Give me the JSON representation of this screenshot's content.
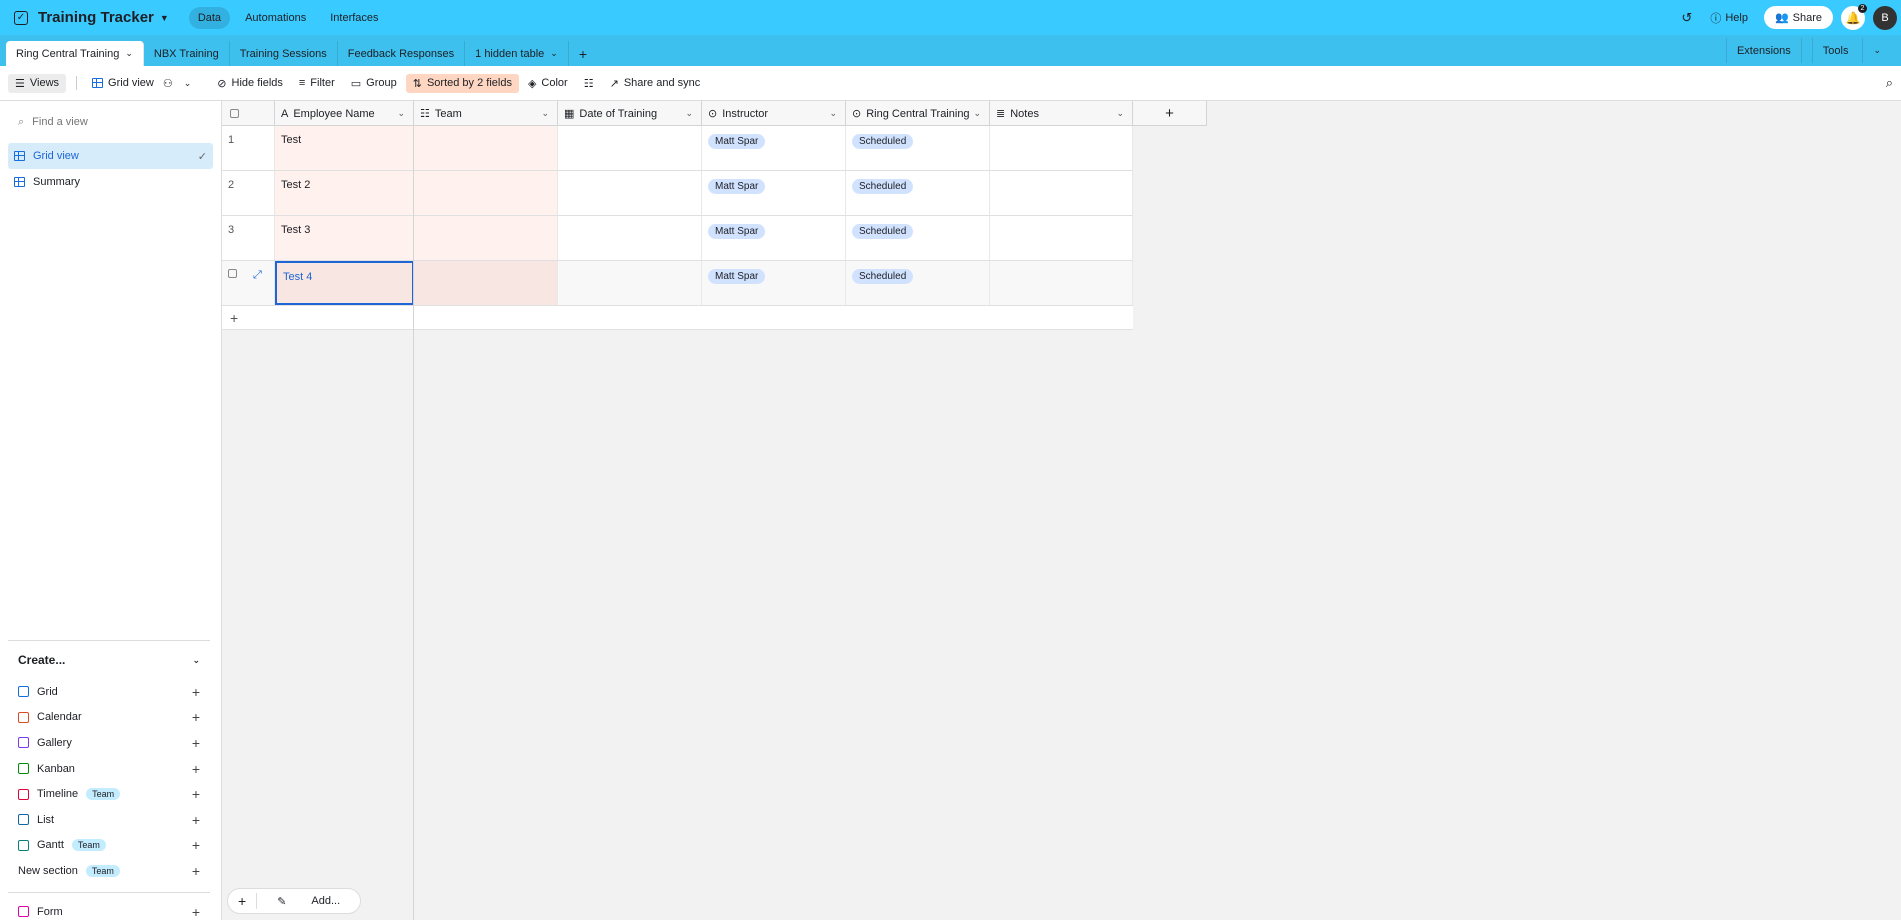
{
  "topbar": {
    "base_title": "Training Tracker",
    "nav": [
      "Data",
      "Automations",
      "Interfaces"
    ],
    "help": "Help",
    "share": "Share",
    "notifications": "2",
    "avatar": "B"
  },
  "tabs": {
    "items": [
      "Ring Central Training",
      "NBX Training",
      "Training Sessions",
      "Feedback Responses",
      "1 hidden table"
    ],
    "extensions": "Extensions",
    "tools": "Tools"
  },
  "viewbar": {
    "views": "Views",
    "grid_view": "Grid view",
    "hide_fields": "Hide fields",
    "filter": "Filter",
    "group": "Group",
    "sorted": "Sorted by 2 fields",
    "color": "Color",
    "share_sync": "Share and sync"
  },
  "sidebar": {
    "find_placeholder": "Find a view",
    "views": [
      "Grid view",
      "Summary"
    ],
    "create_title": "Create...",
    "create_items": [
      {
        "label": "Grid",
        "color": "#166ee1"
      },
      {
        "label": "Calendar",
        "color": "#d74d26"
      },
      {
        "label": "Gallery",
        "color": "#7c39ed"
      },
      {
        "label": "Kanban",
        "color": "#048a0e"
      },
      {
        "label": "Timeline",
        "color": "#dc043b",
        "badge": "Team"
      },
      {
        "label": "List",
        "color": "#0f68a2"
      },
      {
        "label": "Gantt",
        "color": "#0d7f78",
        "badge": "Team"
      }
    ],
    "new_section": "New section",
    "new_section_badge": "Team",
    "form": "Form"
  },
  "grid": {
    "columns": [
      "Employee Name",
      "Team",
      "Date of Training",
      "Instructor",
      "Ring Central Training",
      "Notes"
    ],
    "rows": [
      {
        "num": "1",
        "name": "Test",
        "team": "",
        "date": "",
        "instructor": "Matt Spar",
        "status": "Scheduled",
        "notes": ""
      },
      {
        "num": "2",
        "name": "Test 2",
        "team": "",
        "date": "",
        "instructor": "Matt Spar",
        "status": "Scheduled",
        "notes": ""
      },
      {
        "num": "3",
        "name": "Test 3",
        "team": "",
        "date": "",
        "instructor": "Matt Spar",
        "status": "Scheduled",
        "notes": ""
      },
      {
        "num": "",
        "name": "Test 4",
        "team": "",
        "date": "",
        "instructor": "Matt Spar",
        "status": "Scheduled",
        "notes": ""
      }
    ],
    "add_label": "Add..."
  }
}
